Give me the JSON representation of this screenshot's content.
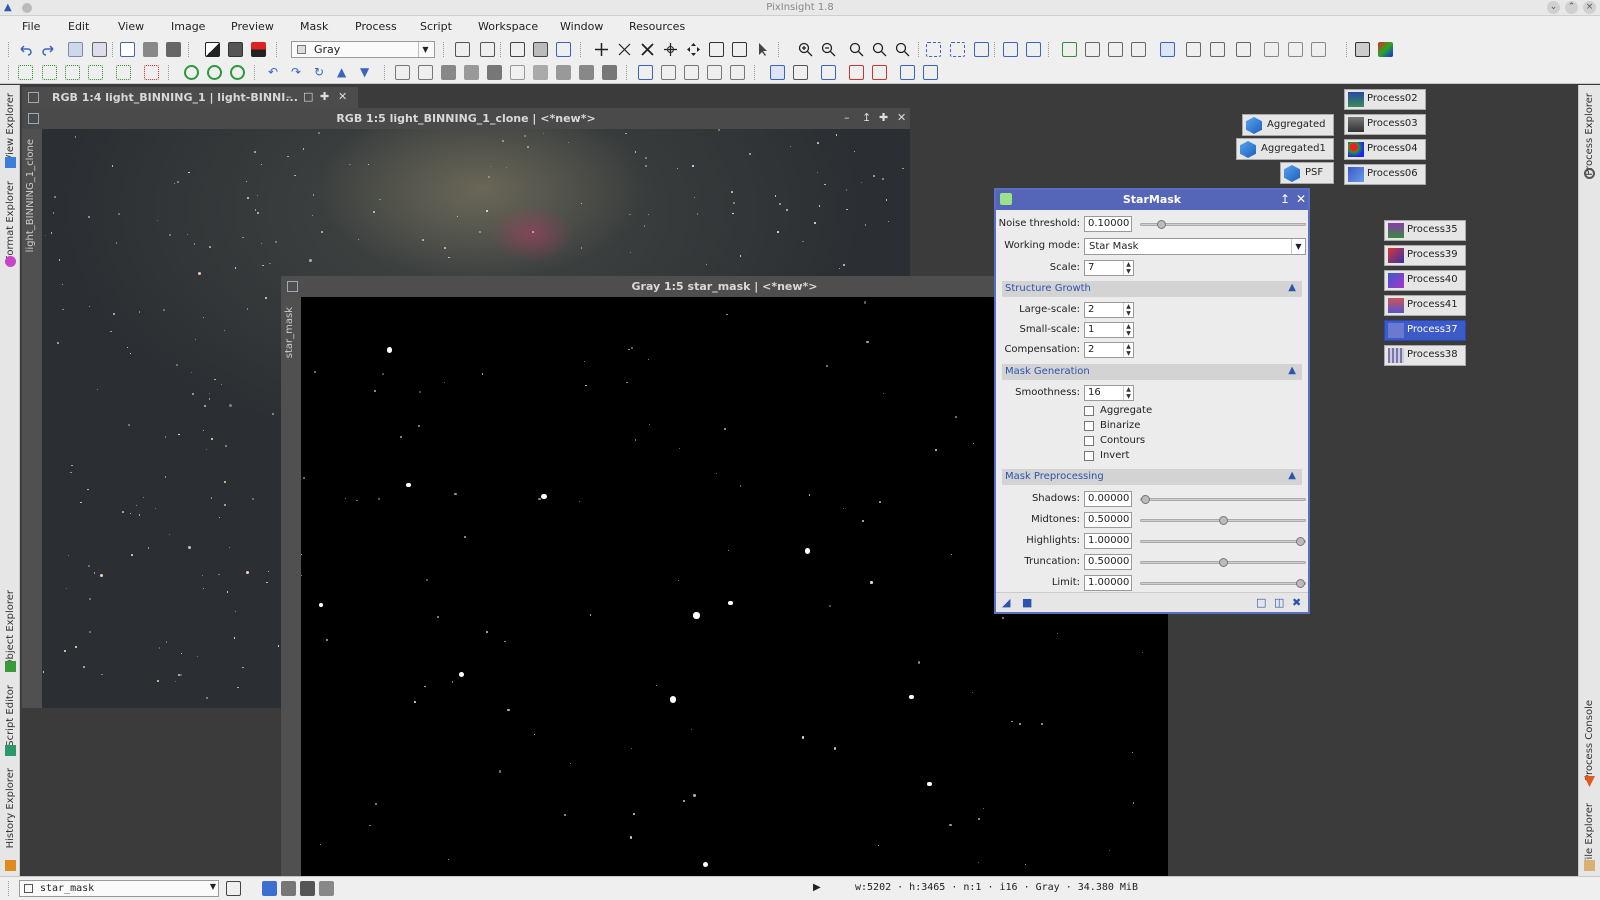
{
  "app": {
    "title": "PixInsight 1.8"
  },
  "menu": [
    "File",
    "Edit",
    "View",
    "Image",
    "Preview",
    "Mask",
    "Process",
    "Script",
    "Workspace",
    "Window",
    "Resources"
  ],
  "toolbar": {
    "color_space": "Gray"
  },
  "left_dock": {
    "tabs": [
      "View Explorer",
      "Format Explorer",
      "Object Explorer",
      "Script Editor",
      "History Explorer"
    ]
  },
  "right_dock": {
    "tabs": [
      "Process Explorer",
      "Process Console",
      "File Explorer"
    ]
  },
  "windows": {
    "win1": {
      "title": "RGB 1:4 light_BINNING_1 | light-BINNI..."
    },
    "win2": {
      "title": "RGB 1:5 light_BINNING_1_clone | <*new*>",
      "side_label": "light_BINNING_1_clone"
    },
    "win3": {
      "title": "Gray 1:5 star_mask | <*new*>",
      "side_label": "star_mask"
    }
  },
  "process_icons": {
    "aggregated": [
      "Aggregated",
      "Aggregated1",
      "PSF"
    ],
    "top": [
      "Process02",
      "Process03",
      "Process04",
      "Process06"
    ],
    "mid": [
      "Process35",
      "Process39",
      "Process40",
      "Process41",
      "Process37",
      "Process38"
    ],
    "selected": "Process37"
  },
  "starmask": {
    "title": "StarMask",
    "noise_threshold": {
      "label": "Noise threshold:",
      "value": "0.10000",
      "position": 0.1
    },
    "working_mode": {
      "label": "Working mode:",
      "value": "Star Mask"
    },
    "scale": {
      "label": "Scale:",
      "value": "7"
    },
    "structure_growth": {
      "title": "Structure Growth",
      "large_scale": {
        "label": "Large-scale:",
        "value": "2"
      },
      "small_scale": {
        "label": "Small-scale:",
        "value": "1"
      },
      "compensation": {
        "label": "Compensation:",
        "value": "2"
      }
    },
    "mask_generation": {
      "title": "Mask Generation",
      "smoothness": {
        "label": "Smoothness:",
        "value": "16"
      },
      "aggregate": "Aggregate",
      "binarize": "Binarize",
      "contours": "Contours",
      "invert": "Invert"
    },
    "mask_preprocessing": {
      "title": "Mask Preprocessing",
      "shadows": {
        "label": "Shadows:",
        "value": "0.00000",
        "position": 0.0
      },
      "midtones": {
        "label": "Midtones:",
        "value": "0.50000",
        "position": 0.5
      },
      "highlights": {
        "label": "Highlights:",
        "value": "1.00000",
        "position": 1.0
      },
      "truncation": {
        "label": "Truncation:",
        "value": "0.50000",
        "position": 0.5
      },
      "limit": {
        "label": "Limit:",
        "value": "1.00000",
        "position": 1.0
      }
    }
  },
  "statusbar": {
    "view": "star_mask",
    "info": "w:5202 · h:3465 · n:1 · i16 · Gray · 34.380 MiB"
  }
}
